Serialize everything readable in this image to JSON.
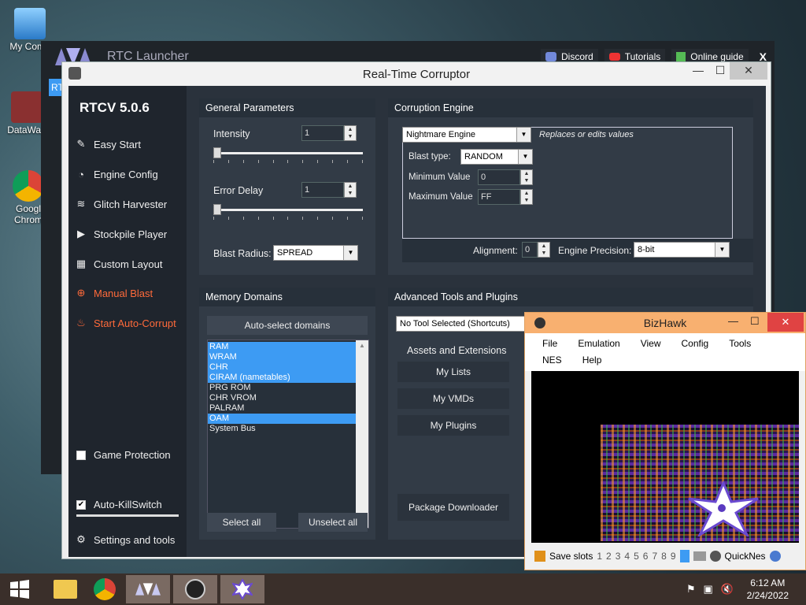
{
  "desktop": {
    "icons": [
      {
        "label": "My Comp"
      },
      {
        "label": "DataWag"
      },
      {
        "label": "Googl Chrom"
      }
    ]
  },
  "launcher": {
    "title": "RTC Launcher",
    "buttons": {
      "discord": "Discord",
      "tutorials": "Tutorials",
      "online_guide": "Online guide"
    },
    "close": "X",
    "side_stub": "RT"
  },
  "rtc": {
    "window_title": "Real-Time Corruptor",
    "version": "RTCV 5.0.6",
    "nav": {
      "easy_start": "Easy Start",
      "engine_config": "Engine Config",
      "glitch_harvester": "Glitch Harvester",
      "stockpile_player": "Stockpile Player",
      "custom_layout": "Custom Layout",
      "manual_blast": "Manual Blast",
      "start_auto_corrupt": "Start Auto-Corrupt",
      "game_protection": "Game Protection",
      "auto_killswitch": "Auto-KillSwitch",
      "settings": "Settings and tools"
    },
    "checks": {
      "game_protection": false,
      "auto_killswitch": true
    },
    "general": {
      "title": "General Parameters",
      "intensity_label": "Intensity",
      "intensity_value": "1",
      "error_delay_label": "Error Delay",
      "error_delay_value": "1",
      "blast_radius_label": "Blast Radius:",
      "blast_radius_value": "SPREAD"
    },
    "engine": {
      "title": "Corruption Engine",
      "selected": "Nightmare Engine",
      "description": "Replaces or edits values",
      "blast_type_label": "Blast type:",
      "blast_type_value": "RANDOM",
      "min_label": "Minimum Value",
      "min_value": "0",
      "max_label": "Maximum Value",
      "max_value": "FF",
      "alignment_label": "Alignment:",
      "alignment_value": "0",
      "precision_label": "Engine Precision:",
      "precision_value": "8-bit"
    },
    "memory": {
      "title": "Memory Domains",
      "auto_select": "Auto-select domains",
      "domains": [
        {
          "name": "RAM",
          "selected": true
        },
        {
          "name": "WRAM",
          "selected": true
        },
        {
          "name": "CHR",
          "selected": true
        },
        {
          "name": "CIRAM (nametables)",
          "selected": true
        },
        {
          "name": "PRG ROM",
          "selected": false
        },
        {
          "name": "CHR VROM",
          "selected": false
        },
        {
          "name": "PALRAM",
          "selected": false
        },
        {
          "name": "OAM",
          "selected": true
        },
        {
          "name": "System Bus",
          "selected": false
        }
      ],
      "select_all": "Select all",
      "unselect_all": "Unselect all"
    },
    "tools": {
      "title": "Advanced Tools and Plugins",
      "selected": "No Tool Selected (Shortcuts)",
      "assets": "Assets and Extensions",
      "my_lists": "My Lists",
      "my_vmds": "My VMDs",
      "my_plugins": "My Plugins",
      "package_downloader": "Package Downloader"
    }
  },
  "bizhawk": {
    "title": "BizHawk",
    "menu": [
      "File",
      "Emulation",
      "View",
      "Config",
      "Tools",
      "NES",
      "Help"
    ],
    "save_slots_label": "Save slots",
    "slots": [
      "1",
      "2",
      "3",
      "4",
      "5",
      "6",
      "7",
      "8",
      "9"
    ],
    "core": "QuickNes"
  },
  "clock": {
    "time": "6:12 AM",
    "date": "2/24/2022"
  },
  "colors": {
    "accent_red": "#ff6a3a",
    "selection_blue": "#3d9bf3",
    "bizhawk_title": "#f8b070"
  }
}
